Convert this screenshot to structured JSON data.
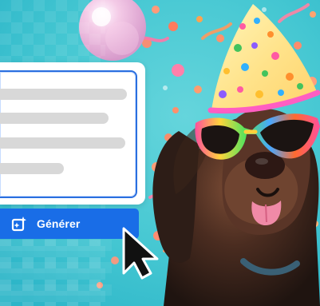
{
  "generate_button": {
    "label": "Générer",
    "icon": "sparkle-frame-icon",
    "color": "#196de7"
  },
  "prompt_box": {
    "focus_color": "#2a6fdf",
    "placeholder_line_color": "#d8d8d8"
  },
  "background": {
    "color": "#49c9d4"
  }
}
